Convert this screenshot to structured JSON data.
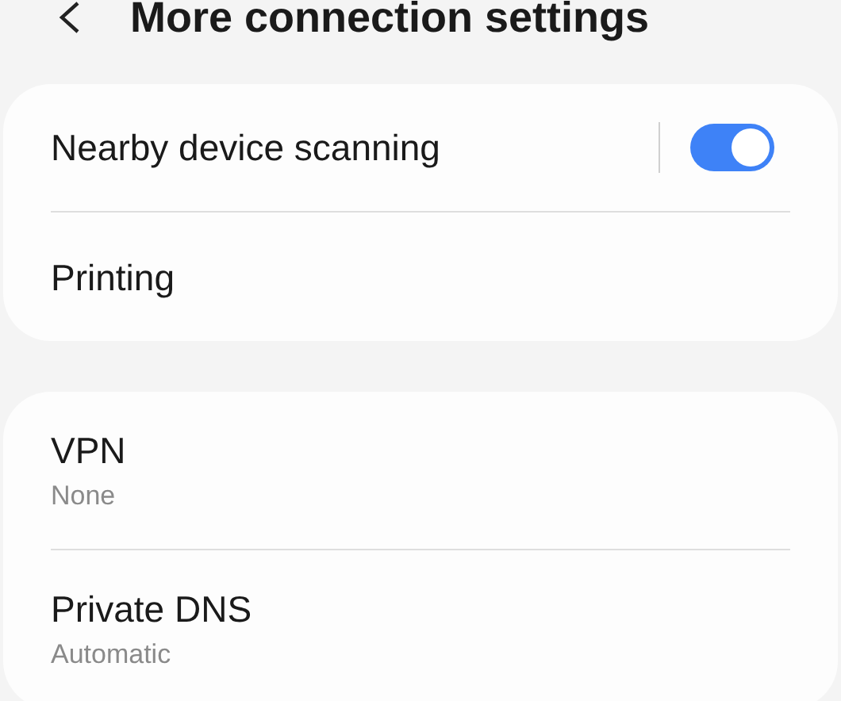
{
  "header": {
    "title": "More connection settings"
  },
  "groups": [
    {
      "items": [
        {
          "kind": "toggle",
          "title": "Nearby device scanning",
          "on": true
        },
        {
          "kind": "plain",
          "title": "Printing"
        }
      ]
    },
    {
      "items": [
        {
          "kind": "plain",
          "title": "VPN",
          "subtitle": "None"
        },
        {
          "kind": "plain",
          "title": "Private DNS",
          "subtitle": "Automatic"
        }
      ]
    }
  ]
}
